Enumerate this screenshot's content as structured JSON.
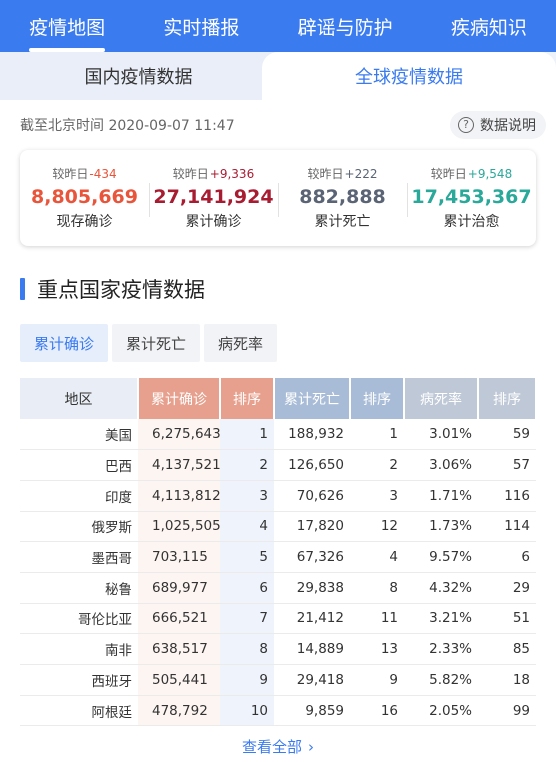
{
  "nav": [
    {
      "label": "疫情地图",
      "active": true
    },
    {
      "label": "实时播报",
      "active": false
    },
    {
      "label": "辟谣与防护",
      "active": false
    },
    {
      "label": "疾病知识",
      "active": false
    }
  ],
  "data_tabs": {
    "domestic": "国内疫情数据",
    "global": "全球疫情数据"
  },
  "update_time": "截至北京时间 2020-09-07 11:47",
  "explain_label": "数据说明",
  "summary": [
    {
      "delta_label": "较昨日",
      "delta": "-434",
      "value": "8,805,669",
      "label": "现存确诊",
      "color": "#e8553a",
      "delta_color": "#e8553a"
    },
    {
      "delta_label": "较昨日",
      "delta": "+9,336",
      "value": "27,141,924",
      "label": "累计确诊",
      "color": "#a81c32",
      "delta_color": "#a81c32"
    },
    {
      "delta_label": "较昨日",
      "delta": "+222",
      "value": "882,888",
      "label": "累计死亡",
      "color": "#5a6475",
      "delta_color": "#5a6475"
    },
    {
      "delta_label": "较昨日",
      "delta": "+9,548",
      "value": "17,453,367",
      "label": "累计治愈",
      "color": "#2aa89a",
      "delta_color": "#2aa89a"
    }
  ],
  "section_title": "重点国家疫情数据",
  "filter_tabs": [
    {
      "label": "累计确诊",
      "active": true
    },
    {
      "label": "累计死亡",
      "active": false
    },
    {
      "label": "病死率",
      "active": false
    }
  ],
  "table": {
    "headers": [
      "地区",
      "累计确诊",
      "排序",
      "累计死亡",
      "排序",
      "病死率",
      "排序"
    ],
    "rows": [
      [
        "美国",
        "6,275,643",
        "1",
        "188,932",
        "1",
        "3.01%",
        "59"
      ],
      [
        "巴西",
        "4,137,521",
        "2",
        "126,650",
        "2",
        "3.06%",
        "57"
      ],
      [
        "印度",
        "4,113,812",
        "3",
        "70,626",
        "3",
        "1.71%",
        "116"
      ],
      [
        "俄罗斯",
        "1,025,505",
        "4",
        "17,820",
        "12",
        "1.73%",
        "114"
      ],
      [
        "墨西哥",
        "703,115",
        "5",
        "67,326",
        "4",
        "9.57%",
        "6"
      ],
      [
        "秘鲁",
        "689,977",
        "6",
        "29,838",
        "8",
        "4.32%",
        "29"
      ],
      [
        "哥伦比亚",
        "666,521",
        "7",
        "21,412",
        "11",
        "3.21%",
        "51"
      ],
      [
        "南非",
        "638,517",
        "8",
        "14,889",
        "13",
        "2.33%",
        "85"
      ],
      [
        "西班牙",
        "505,441",
        "9",
        "29,418",
        "9",
        "5.82%",
        "18"
      ],
      [
        "阿根廷",
        "478,792",
        "10",
        "9,859",
        "16",
        "2.05%",
        "99"
      ]
    ]
  },
  "see_all": "查看全部",
  "see_all_icon": "chevron-right-icon"
}
